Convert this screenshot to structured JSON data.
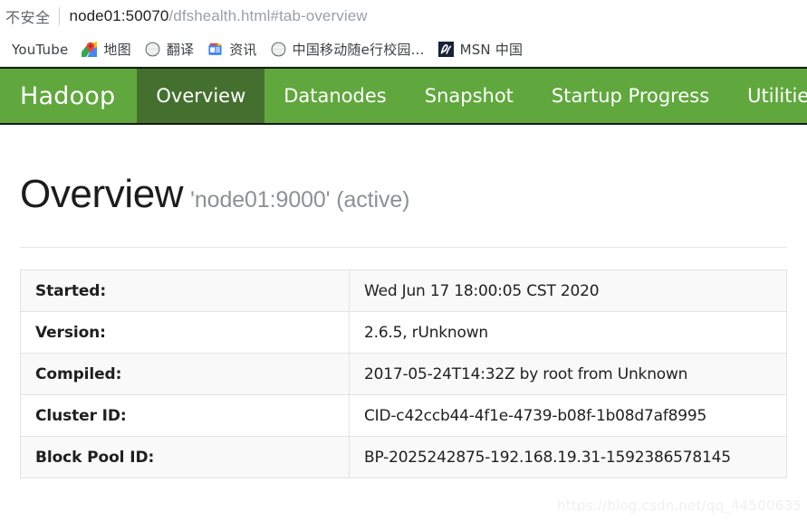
{
  "browser": {
    "security_label": "不安全",
    "url_host": "node01:50070",
    "url_path": "/dfshealth.html#tab-overview",
    "bookmarks": [
      {
        "label": "YouTube",
        "icon": "youtube-icon",
        "has_icon": false
      },
      {
        "label": "地图",
        "icon": "google-maps-icon",
        "has_icon": true
      },
      {
        "label": "翻译",
        "icon": "globe-icon",
        "has_icon": true
      },
      {
        "label": "资讯",
        "icon": "google-news-icon",
        "has_icon": true
      },
      {
        "label": "中国移动随e行校园...",
        "icon": "globe-icon",
        "has_icon": true
      },
      {
        "label": "MSN 中国",
        "icon": "msn-icon",
        "has_icon": true
      }
    ]
  },
  "navbar": {
    "brand": "Hadoop",
    "items": [
      {
        "label": "Overview",
        "active": true,
        "caret": false
      },
      {
        "label": "Datanodes",
        "active": false,
        "caret": false
      },
      {
        "label": "Snapshot",
        "active": false,
        "caret": false
      },
      {
        "label": "Startup Progress",
        "active": false,
        "caret": false
      },
      {
        "label": "Utilities",
        "active": false,
        "caret": true
      }
    ],
    "colors": {
      "bar": "#60a83d",
      "active": "#44702f",
      "text": "#ffffff"
    }
  },
  "page": {
    "heading": "Overview",
    "subtitle": "'node01:9000' (active)",
    "table": {
      "rows": [
        {
          "label": "Started:",
          "value": "Wed Jun 17 18:00:05 CST 2020"
        },
        {
          "label": "Version:",
          "value": "2.6.5, rUnknown"
        },
        {
          "label": "Compiled:",
          "value": "2017-05-24T14:32Z by root from Unknown"
        },
        {
          "label": "Cluster ID:",
          "value": "CID-c42ccb44-4f1e-4739-b08f-1b08d7af8995"
        },
        {
          "label": "Block Pool ID:",
          "value": "BP-2025242875-192.168.19.31-1592386578145"
        }
      ]
    }
  },
  "watermark": "https://blog.csdn.net/qq_44500635"
}
